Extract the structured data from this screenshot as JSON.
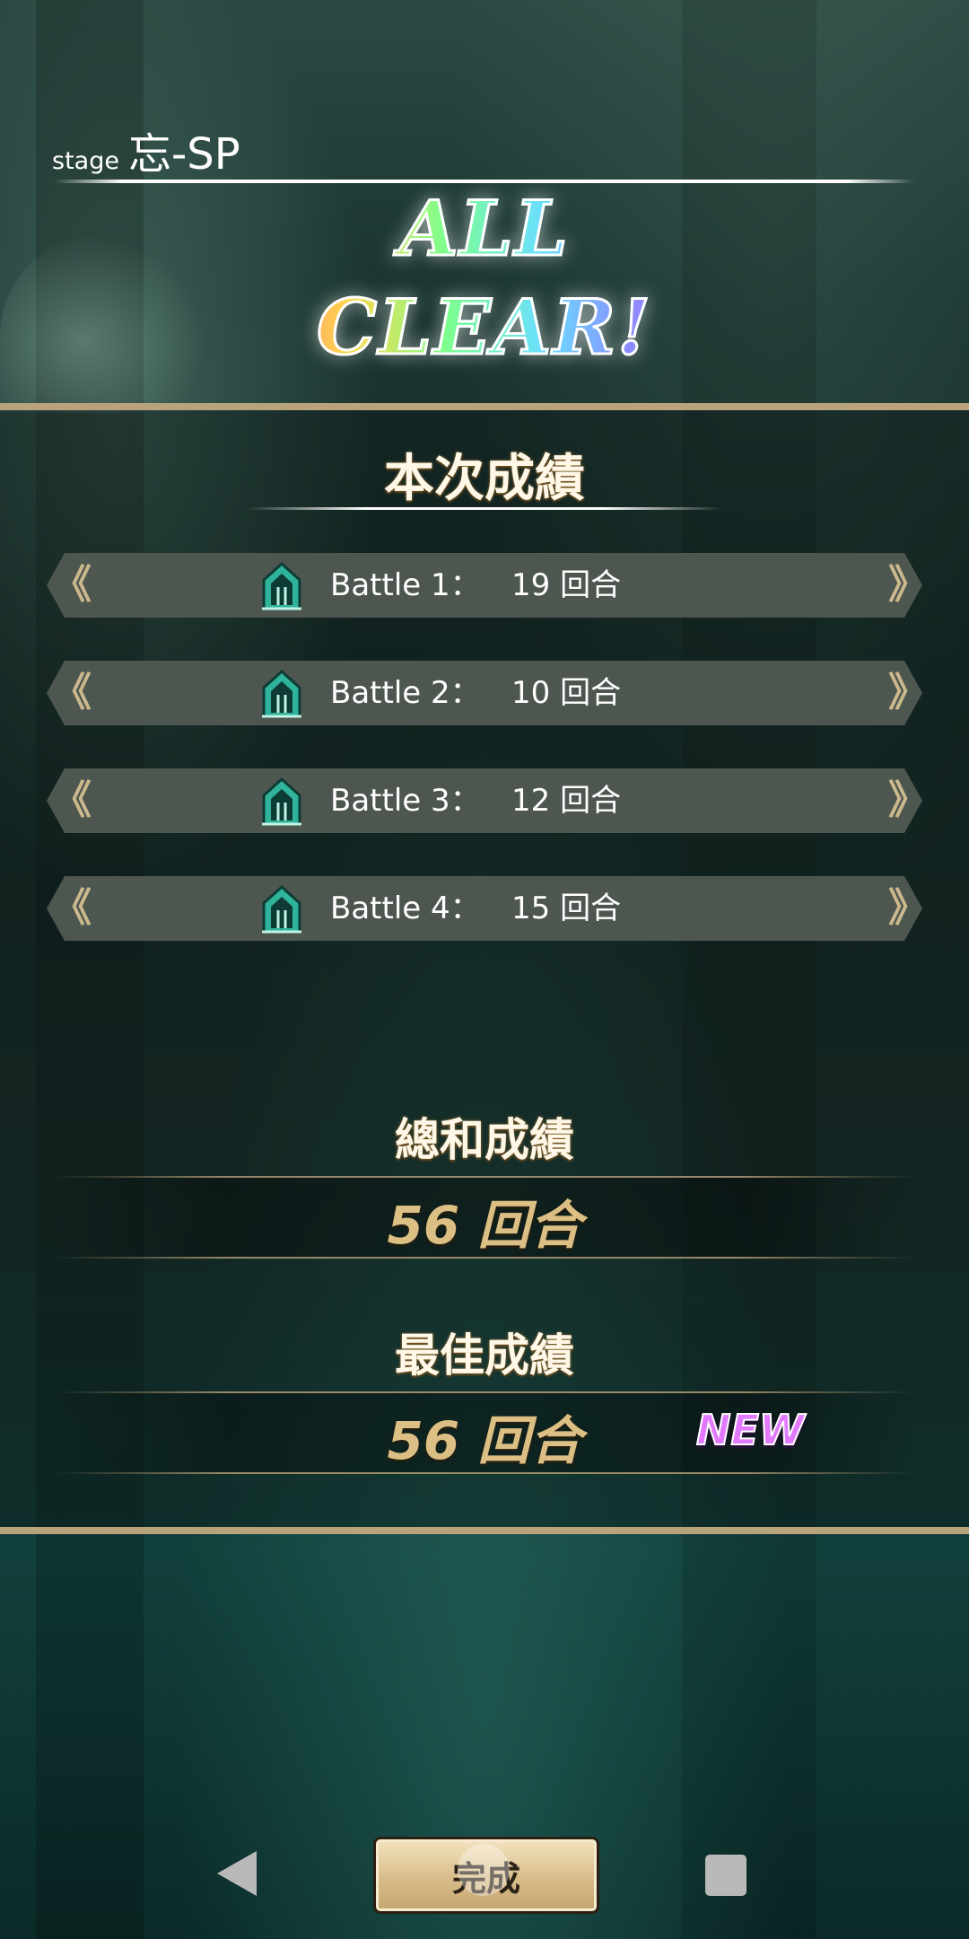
{
  "header": {
    "stage_prefix": "stage",
    "stage_name": "忘-SP",
    "banner": "ALL CLEAR!"
  },
  "current": {
    "title": "本次成績",
    "battles": [
      {
        "label": "Battle 1：",
        "value": "19 回合"
      },
      {
        "label": "Battle 2：",
        "value": "10 回合"
      },
      {
        "label": "Battle 3：",
        "value": "12 回合"
      },
      {
        "label": "Battle 4：",
        "value": "15 回合"
      }
    ]
  },
  "total": {
    "title": "總和成績",
    "value": "56 回合"
  },
  "best": {
    "title": "最佳成績",
    "value": "56 回合",
    "badge": "NEW"
  },
  "footer": {
    "done_label": "完成"
  },
  "colors": {
    "gold_border": "#b9a37a",
    "score_gold": "#dcbf84",
    "new_badge": "#e27aff",
    "row_bg": "#4d5750",
    "gate_icon": "#2fb39a"
  },
  "icons": {
    "battle": "gate-icon",
    "row_left": "double-chevron-left-icon",
    "row_right": "double-chevron-right-icon",
    "nav_back": "triangle-back-icon",
    "nav_recent": "square-recent-icon"
  }
}
